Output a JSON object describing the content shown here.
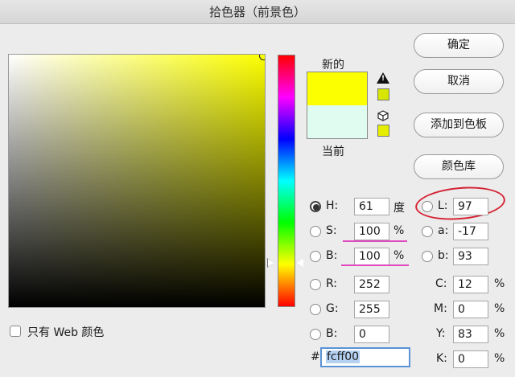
{
  "window": {
    "title": "拾色器（前景色）"
  },
  "preview": {
    "new_label": "新的",
    "current_label": "当前",
    "new_color": "#fcff00",
    "current_color": "#e0fbf0"
  },
  "icons": {
    "gamut_warning": "warning-triangle-icon",
    "web_safe": "cube-icon"
  },
  "buttons": {
    "ok": "确定",
    "cancel": "取消",
    "add_swatch": "添加到色板",
    "libraries": "颜色库"
  },
  "hsb": {
    "h": {
      "label": "H:",
      "value": "61",
      "unit": "度"
    },
    "s": {
      "label": "S:",
      "value": "100",
      "unit": "%"
    },
    "b": {
      "label": "B:",
      "value": "100",
      "unit": "%"
    }
  },
  "rgb": {
    "r": {
      "label": "R:",
      "value": "252"
    },
    "g": {
      "label": "G:",
      "value": "255"
    },
    "b": {
      "label": "B:",
      "value": "0"
    }
  },
  "lab": {
    "l": {
      "label": "L:",
      "value": "97"
    },
    "a": {
      "label": "a:",
      "value": "-17"
    },
    "b": {
      "label": "b:",
      "value": "93"
    }
  },
  "cmyk": {
    "c": {
      "label": "C:",
      "value": "12",
      "unit": "%"
    },
    "m": {
      "label": "M:",
      "value": "0",
      "unit": "%"
    },
    "y": {
      "label": "Y:",
      "value": "83",
      "unit": "%"
    },
    "k": {
      "label": "K:",
      "value": "0",
      "unit": "%"
    }
  },
  "hex": {
    "label": "#",
    "value": "fcff00"
  },
  "web_only": {
    "label": "只有 Web 颜色"
  },
  "colors": {
    "annotation_pink": "#e04bc0",
    "annotation_red": "#d42435",
    "accent": "#5a93d6"
  }
}
